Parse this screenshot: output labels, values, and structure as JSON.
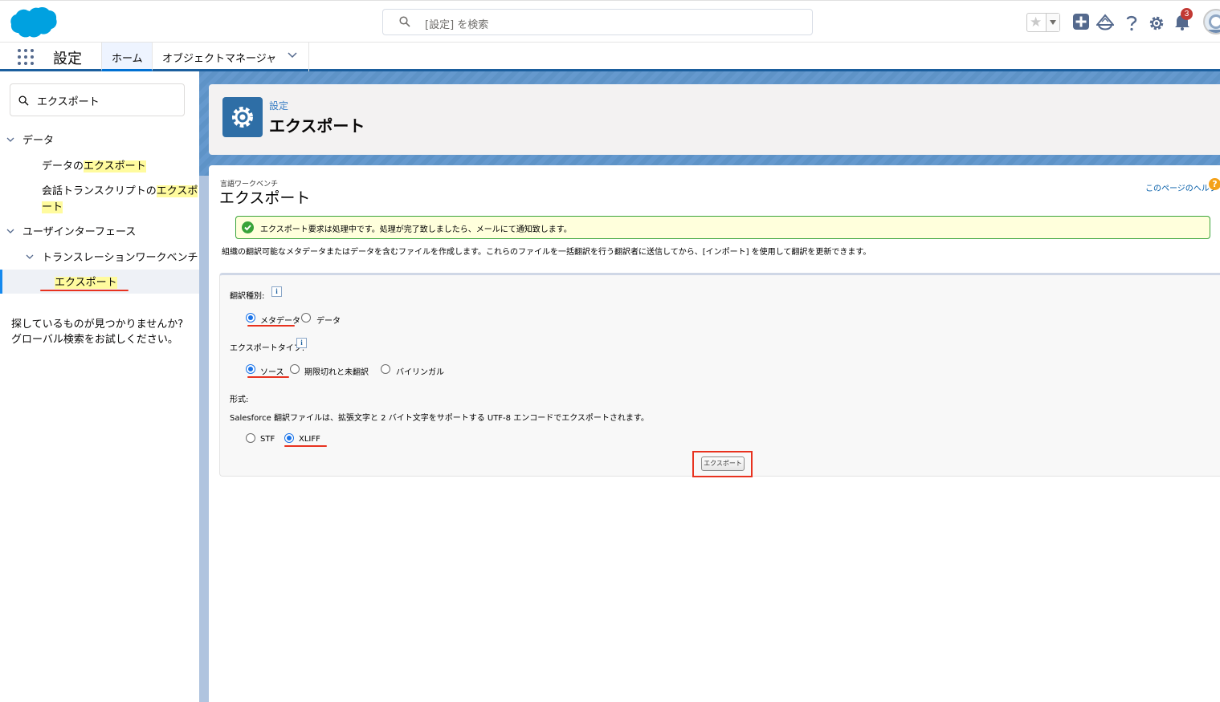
{
  "header": {
    "search_placeholder": "[設定] を検索",
    "notification_count": "3"
  },
  "context_bar": {
    "app_name": "設定",
    "tabs": [
      {
        "label": "ホーム"
      },
      {
        "label": "オブジェクトマネージャ"
      }
    ]
  },
  "sidebar": {
    "search_value": "エクスポート",
    "tree": {
      "data_label": "データ",
      "data_export_prefix": "データの",
      "data_export_hl": "エクスポート",
      "transcript_prefix": "会話トランスクリプトの",
      "transcript_hl1": "エクスポ",
      "transcript_hl2": "ート",
      "ui_label": "ユーザインターフェース",
      "workbench_label": "トランスレーションワークベンチ",
      "export_label": "エクスポート"
    },
    "help_line1": "探しているものが見つかりませんか?",
    "help_line2": "グローバル検索をお試しください。"
  },
  "page_header": {
    "subtitle": "設定",
    "title": "エクスポート"
  },
  "content": {
    "subtitle": "言語ワークベンチ",
    "title": "エクスポート",
    "help_link": "このページのヘルプ",
    "help_icon": "?",
    "message": "エクスポート要求は処理中です。処理が完了致しましたら、メールにて通知致します。",
    "description": "組織の翻訳可能なメタデータまたはデータを含むファイルを作成します。これらのファイルを一括翻訳を行う翻訳者に送信してから、[インポート] を使用して翻訳を更新できます。",
    "form": {
      "translation_type_label": "翻訳種別:",
      "translation_type_options": [
        "メタデータ",
        "データ"
      ],
      "export_type_label": "エクスポートタイプ:",
      "export_type_options": [
        "ソース",
        "期限切れと未翻訳",
        "バイリンガル"
      ],
      "format_label": "形式:",
      "format_note": "Salesforce 翻訳ファイルは、拡張文字と 2 バイト文字をサポートする UTF-8 エンコードでエクスポートされます。",
      "format_options": [
        "STF",
        "XLIFF"
      ],
      "info_icon": "i",
      "export_button": "エクスポート"
    }
  },
  "colors": {
    "brand_blue": "#1b5f9e",
    "salesforce_cloud": "#00a1e0",
    "success_green": "#39a33a",
    "highlight_yellow": "#fffb9e",
    "annotation_red": "#e8321f"
  }
}
